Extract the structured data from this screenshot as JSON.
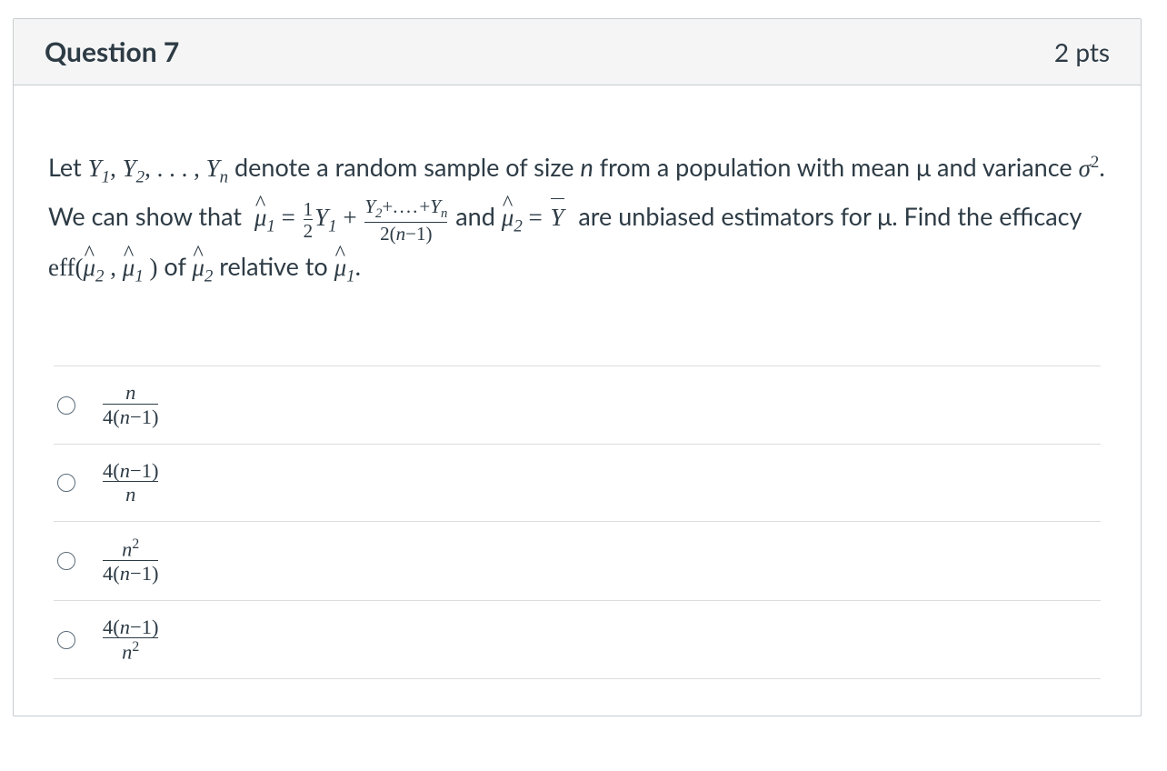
{
  "question": {
    "title": "Question 7",
    "points": "2 pts",
    "promptHtml": "Let <span class=\"math\"><i>Y</i><span class=\"sub\">1</span>, <i>Y</i><span class=\"sub\">2</span>, . . . , <i>Y</i><span class=\"sub\">n</span></span> denote a random sample of size <span class=\"ital\">n</span> from a population with mean μ and variance <span class=\"math\"><i>σ</i><span class=\"sup\">2</span></span>. We can show that &nbsp;<span class=\"math\"><span class=\"hat\"><i>μ</i></span><span class=\"sub\">1</span> = <span class=\"frac\"><span class=\"num\">1</span><span class=\"den\">2</span></span><i>Y</i><span class=\"sub\">1</span> + <span class=\"frac\"><span class=\"num\"><i>Y</i><span class=\"sub\">2</span>+<span style=\"letter-spacing:2px;\">....</span>+<i>Y</i><span class=\"sub\">n</span></span><span class=\"den\">2(<i>n</i>&minus;1)</span></span></span> and <span class=\"math\"><span class=\"hat\"><i>μ</i></span><span class=\"sub\">2</span> = <span class=\"bar\"><i>Y</i></span></span>&nbsp; are unbiased estimators for μ. Find the efficacy <span class=\"math\">eff(<span class=\"hat\"><i>μ</i></span><span class=\"sub\">2</span> , <span class=\"hat\"><i>μ</i></span><span class=\"sub\">1</span> )</span> of <span class=\"math\"><span class=\"hat\"><i>μ</i></span><span class=\"sub\">2</span></span> relative to <span class=\"math\"><span class=\"hat\"><i>μ</i></span><span class=\"sub\">1</span></span>.",
    "options": [
      {
        "id": "opt1",
        "html": "<span class=\"frac\"><span class=\"num\"><i>n</i></span><span class=\"den\">4(<i>n</i>&minus;1)</span></span>"
      },
      {
        "id": "opt2",
        "html": "<span class=\"frac\"><span class=\"num\">4(<i>n</i>&minus;1)</span><span class=\"den\"><i>n</i></span></span>"
      },
      {
        "id": "opt3",
        "html": "<span class=\"frac\"><span class=\"num\"><i>n</i><span class=\"sup\">2</span></span><span class=\"den\">4(<i>n</i>&minus;1)</span></span>"
      },
      {
        "id": "opt4",
        "html": "<span class=\"frac\"><span class=\"num\">4(<i>n</i>&minus;1)</span><span class=\"den\"><i>n</i><span class=\"sup\">2</span></span></span>"
      }
    ]
  }
}
